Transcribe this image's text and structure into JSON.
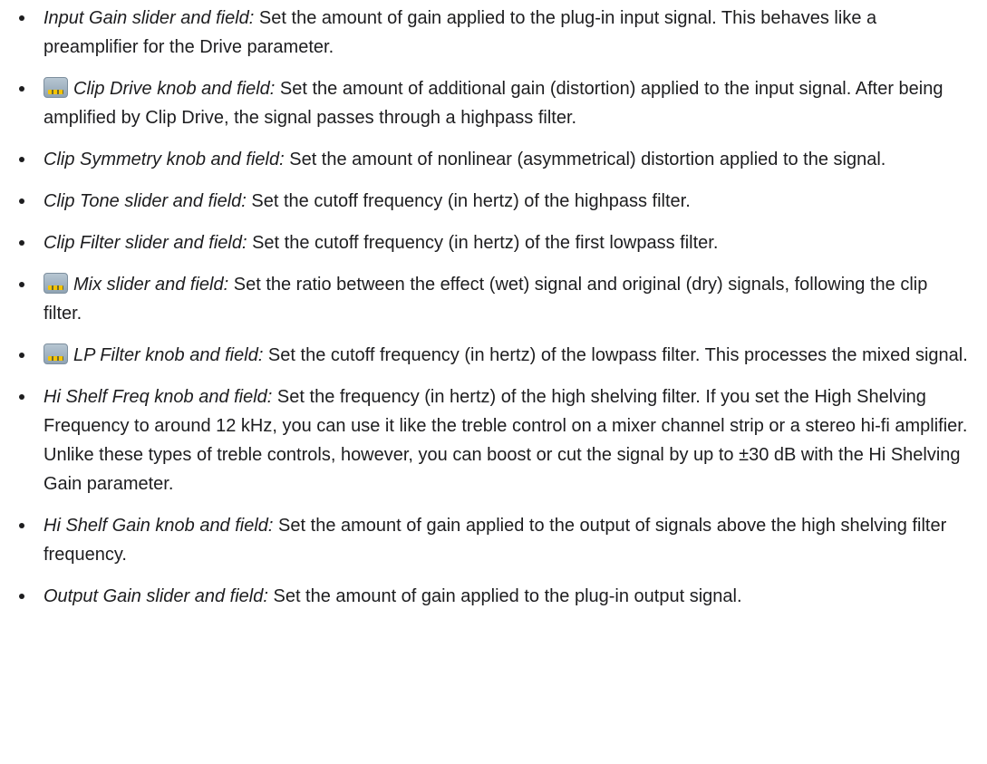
{
  "items": [
    {
      "term": "Input Gain slider and field:",
      "text": " Set the amount of gain applied to the plug-in input signal. This behaves like a preamplifier for the Drive parameter.",
      "has_badge": false
    },
    {
      "term": "Clip Drive knob and field:",
      "text": " Set the amount of additional gain (distortion) applied to the input signal. After being amplified by Clip Drive, the signal passes through a highpass filter.",
      "has_badge": true
    },
    {
      "term": "Clip Symmetry knob and field:",
      "text": " Set the amount of nonlinear (asymmetrical) distortion applied to the signal.",
      "has_badge": false
    },
    {
      "term": "Clip Tone slider and field:",
      "text": " Set the cutoff frequency (in hertz) of the highpass filter.",
      "has_badge": false
    },
    {
      "term": "Clip Filter slider and field:",
      "text": " Set the cutoff frequency (in hertz) of the first lowpass filter.",
      "has_badge": false
    },
    {
      "term": "Mix slider and field:",
      "text": " Set the ratio between the effect (wet) signal and original (dry) signals, following the clip filter.",
      "has_badge": true
    },
    {
      "term": "LP Filter knob and field:",
      "text": " Set the cutoff frequency (in hertz) of the lowpass filter. This processes the mixed signal.",
      "has_badge": true
    },
    {
      "term": "Hi Shelf Freq knob and field:",
      "text": " Set the frequency (in hertz) of the high shelving filter. If you set the High Shelving Frequency to around 12 kHz, you can use it like the treble control on a mixer channel strip or a stereo hi-fi amplifier. Unlike these types of treble controls, however, you can boost or cut the signal by up to ±30 dB with the Hi Shelving Gain parameter.",
      "has_badge": false
    },
    {
      "term": "Hi Shelf Gain knob and field:",
      "text": " Set the amount of gain applied to the output of signals above the high shelving filter frequency.",
      "has_badge": false
    },
    {
      "term": "Output Gain slider and field:",
      "text": " Set the amount of gain applied to the plug-in output signal.",
      "has_badge": false
    }
  ],
  "badge_icon": "extended-parameter-icon",
  "colors": {
    "text": "#1d1d1f",
    "background": "#ffffff",
    "badge_accent": "#f5c400"
  }
}
